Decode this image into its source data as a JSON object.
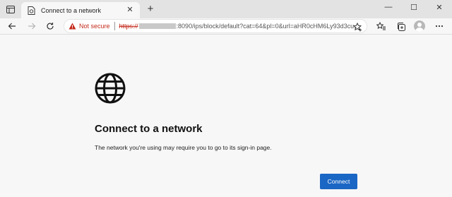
{
  "tab": {
    "title": "Connect to a network",
    "close": "✕",
    "new_tab": "+"
  },
  "window": {
    "minimize": "—",
    "maximize": "☐",
    "close": "✕"
  },
  "address": {
    "warning": "Not secure",
    "url_scheme": "https://",
    "url_rest": ":8090/ips/block/default?cat=64&pl=0&url=aHR0cHM6Ly93d3cu..."
  },
  "content": {
    "heading": "Connect to a network",
    "message": "The network you're using may require you to go to its sign-in page.",
    "button": "Connect"
  },
  "colors": {
    "accent": "#1a66c4",
    "warning": "#c42b1c"
  },
  "icons": [
    "tab-actions-icon",
    "page-icon",
    "back-icon",
    "forward-icon",
    "refresh-icon",
    "warning-icon",
    "favorite-add-icon",
    "favorites-icon",
    "collections-icon",
    "profile-icon",
    "more-icon",
    "globe-icon"
  ]
}
